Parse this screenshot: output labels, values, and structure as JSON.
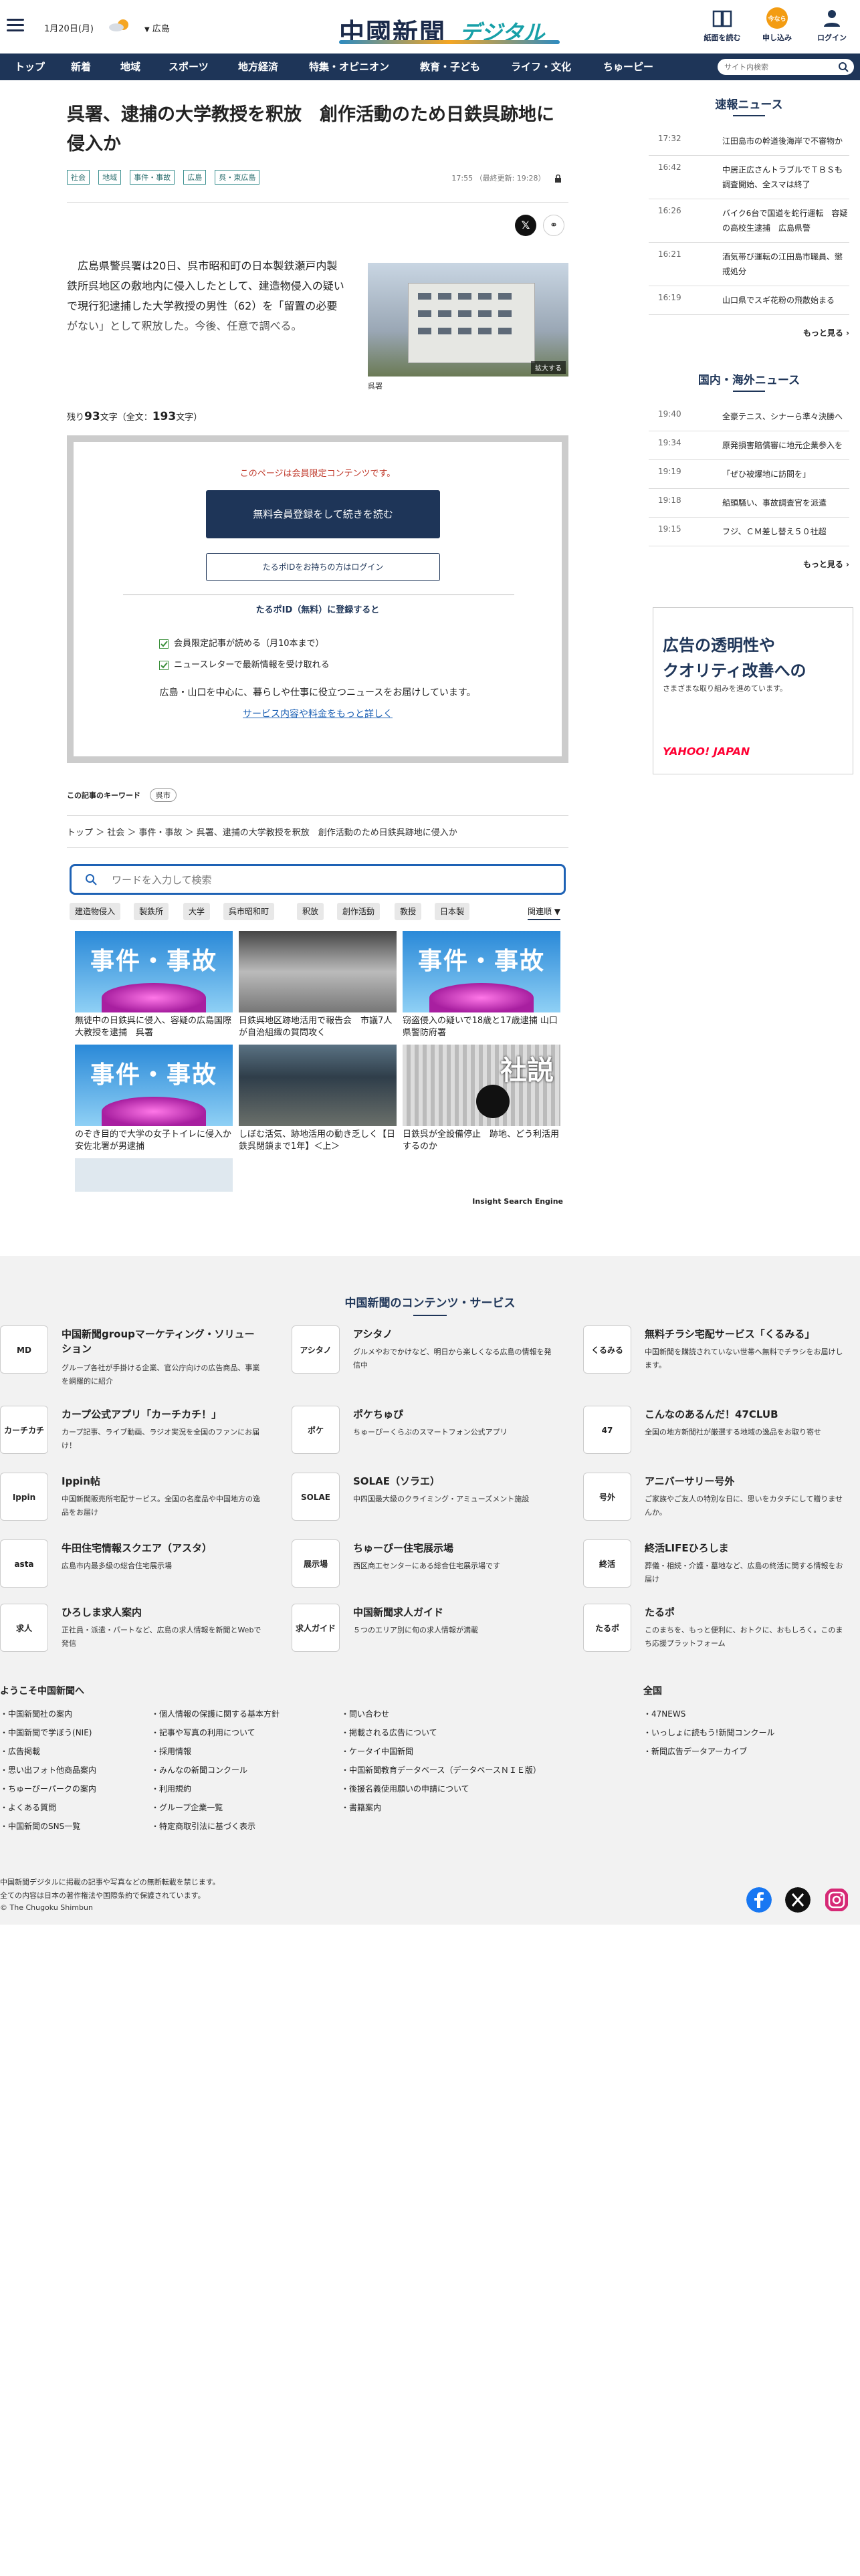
{
  "header": {
    "date": "1月20日(月)",
    "region": "広島",
    "logo_main": "中國新聞",
    "logo_sub": "デジタル",
    "buttons": [
      "紙面を読む",
      "申し込み",
      "ログイン"
    ],
    "apply_badge": "今なら"
  },
  "nav": {
    "items": [
      "トップ",
      "新着",
      "地域",
      "スポーツ",
      "地方経済",
      "特集・オピニオン",
      "教育・子ども",
      "ライフ・文化",
      "ちゅーピー"
    ],
    "search_placeholder": "サイト内検索"
  },
  "article": {
    "headline": "呉署、逮捕の大学教授を釈放　創作活動のため日鉄呉跡地に侵入か",
    "tags": [
      "社会",
      "地域",
      "事件・事故",
      "広島",
      "呉・東広島"
    ],
    "time": "17:55",
    "updated": "（最終更新: 19:28）",
    "lead": "広島県警呉署は20日、呉市昭和町の日本製鉄瀬戸内製鉄所呉地区の敷地内に侵入したとして、建造物侵入の疑いで現行犯逮捕した大学教授の男性（62）を「留置の必要がない」として釈放した。今後、任意で調べる。",
    "photo_expand": "拡大する",
    "photo_caption": "呉署",
    "remain_prefix": "残り",
    "remain_count": "93",
    "remain_mid": "文字（全文：",
    "total_count": "193",
    "remain_suffix": "文字）"
  },
  "paywall": {
    "note": "このページは会員限定コンテンツです。",
    "register_btn": "無料会員登録をして続きを読む",
    "login_btn": "たるポIDをお持ちの方はログイン",
    "register_head": "たるポID（無料）に登録すると",
    "benefits": [
      "会員限定記事が読める（月10本まで）",
      "ニュースレターで最新情報を受け取れる"
    ],
    "desc": "広島・山口を中心に、暮らしや仕事に役立つニュースをお届けしています。",
    "link": "サービス内容や料金をもっと詳しく"
  },
  "keywords": {
    "label": "この記事のキーワード",
    "items": [
      "呉市"
    ]
  },
  "breadcrumb": "トップ ＞ 社会 ＞ 事件・事故 ＞ 呉署、逮捕の大学教授を釈放　創作活動のため日鉄呉跡地に侵入か",
  "related": {
    "search_placeholder": "ワードを入力して検索",
    "chips": [
      "建造物侵入",
      "製鉄所",
      "大学",
      "呉市昭和町",
      "釈放",
      "創作活動",
      "教授",
      "日本製"
    ],
    "sort": "関連順",
    "cards": [
      {
        "title": "無徒中の日鉄呉に侵入、容疑の広島国際大教授を逮捕　呉署",
        "thumb": "事件・事故"
      },
      {
        "title": "日鉄呉地区跡地活用で報告会　市議7人が自治組織の質問攻く",
        "thumb": ""
      },
      {
        "title": "窃盗侵入の疑いで18歳と17歳逮捕 山口県警防府署",
        "thumb": "事件・事故"
      },
      {
        "title": "のぞき目的で大学の女子トイレに侵入か　安佐北署が男逮捕",
        "thumb": "事件・事故"
      },
      {
        "title": "しぼむ活気、跡地活用の動き乏しく【日鉄呉閉鎖まで1年】＜上＞",
        "thumb": ""
      },
      {
        "title": "日鉄呉が全設備停止　跡地、どう利活用するのか",
        "thumb": "社説"
      }
    ],
    "engine": "Insight Search Engine"
  },
  "sidebar": {
    "breaking_title": "速報ニュース",
    "breaking": [
      {
        "time": "17:32",
        "title": "江田島市の幹道後海岸で不審物か"
      },
      {
        "time": "16:42",
        "title": "中居正広さんトラブルでＴＢＳも調査開始、全スマは終了"
      },
      {
        "time": "16:26",
        "title": "バイク6台で国道を蛇行運転　容疑の高校生逮捕　広島県警"
      },
      {
        "time": "16:21",
        "title": "酒気帯び運転の江田島市職員、懲戒処分"
      },
      {
        "time": "16:19",
        "title": "山口県でスギ花粉の飛散始まる"
      }
    ],
    "domestic_title": "国内・海外ニュース",
    "domestic": [
      {
        "time": "19:40",
        "title": "全豪テニス、シナーら準々決勝へ"
      },
      {
        "time": "19:34",
        "title": "原発損害賠償審に地元企業参入を"
      },
      {
        "time": "19:19",
        "title": "「ぜひ被爆地に訪問を」"
      },
      {
        "time": "19:18",
        "title": "船頭騒い、事故調査官を派遣"
      },
      {
        "time": "19:15",
        "title": "フジ、ＣＭ差し替え５０社超"
      }
    ],
    "more": "もっと見る",
    "ad": {
      "line1": "広告の透明性や",
      "line2": "クオリティ改善への",
      "line3": "さまざまな取り組みを進めています。",
      "brand": "YAHOO! JAPAN"
    }
  },
  "footer": {
    "title": "中国新聞のコンテンツ・サービス",
    "services": [
      {
        "icon": "MD",
        "name": "中国新聞groupマーケティング・ソリューション",
        "desc": "グループ各社が手掛ける企業、官公庁向けの広告商品、事業を網羅的に紹介"
      },
      {
        "icon": "アシタノ",
        "name": "アシタノ",
        "desc": "グルメやおでかけなど、明日から楽しくなる広島の情報を発信中"
      },
      {
        "icon": "くるみる",
        "name": "無料チラシ宅配サービス「くるみる」",
        "desc": "中国新聞を購読されていない世帯へ無料でチラシをお届けします。"
      },
      {
        "icon": "カーチカチ",
        "name": "カープ公式アプリ「カーチカチ！」",
        "desc": "カープ記事、ライブ動画、ラジオ実況を全国のファンにお届け！"
      },
      {
        "icon": "ポケ",
        "name": "ポケちゅぴ",
        "desc": "ちゅーぴーくらぶのスマートフォン公式アプリ"
      },
      {
        "icon": "47",
        "name": "こんなのあるんだ！47CLUB",
        "desc": "全国の地方新聞社が厳選する地域の逸品をお取り寄せ"
      },
      {
        "icon": "Ippin",
        "name": "Ippin帖",
        "desc": "中国新聞販売所宅配サービス。全国の名産品や中国地方の逸品をお届け"
      },
      {
        "icon": "SOLAE",
        "name": "SOLAE（ソラエ）",
        "desc": "中四国最大級のクライミング・アミューズメント施設"
      },
      {
        "icon": "号外",
        "name": "アニバーサリー号外",
        "desc": "ご家族やご友人の特別な日に、思いをカタチにして贈りませんか。"
      },
      {
        "icon": "asta",
        "name": "牛田住宅情報スクエア（アスタ）",
        "desc": "広島市内最多級の総合住宅展示場"
      },
      {
        "icon": "展示場",
        "name": "ちゅーぴー住宅展示場",
        "desc": "西区商工センターにある総合住宅展示場です"
      },
      {
        "icon": "終活",
        "name": "終活LIFEひろしま",
        "desc": "葬儀・相続・介護・墓地など、広島の終活に関する情報をお届け"
      },
      {
        "icon": "求人",
        "name": "ひろしま求人案内",
        "desc": "正社員・派遣・パートなど、広島の求人情報を新聞とWebで発信"
      },
      {
        "icon": "求人ガイド",
        "name": "中国新聞求人ガイド",
        "desc": "５つのエリア別に旬の求人情報が満載"
      },
      {
        "icon": "たるポ",
        "name": "たるポ",
        "desc": "このまちを、もっと便利に、おトクに、おもしろく。このまち応援プラットフォーム"
      }
    ],
    "welcome_title": "ようこそ中国新聞へ",
    "welcome_links": [
      [
        "中国新聞社の案内",
        "中国新聞で学ぼう(NIE)",
        "広告掲載",
        "思い出フォト他商品案内",
        "ちゅーぴーパークの案内",
        "よくある質問",
        "中国新聞のSNS一覧"
      ],
      [
        "個人情報の保護に関する基本方針",
        "記事や写真の利用について",
        "採用情報",
        "みんなの新聞コンクール",
        "利用規約",
        "グループ企業一覧",
        "特定商取引法に基づく表示"
      ],
      [
        "問い合わせ",
        "掲載される広告について",
        "ケータイ中国新聞",
        "中国新聞教育データベース（データベースＮＩＥ版）",
        "後援名義使用願いの申請について",
        "書籍案内"
      ]
    ],
    "national_title": "全国",
    "national_links": [
      "47NEWS",
      "いっしょに読もう!新聞コンクール",
      "新聞広告データアーカイブ"
    ],
    "copy1": "中国新聞デジタルに掲載の記事や写真などの無断転載を禁じます。",
    "copy2": "全ての内容は日本の著作権法や国際条約で保護されています。",
    "copy3": "© The Chugoku Shimbun"
  },
  "colors": {
    "navy": "#1e3558",
    "accent_red": "#c0392b",
    "link_blue": "#1e62b5"
  }
}
